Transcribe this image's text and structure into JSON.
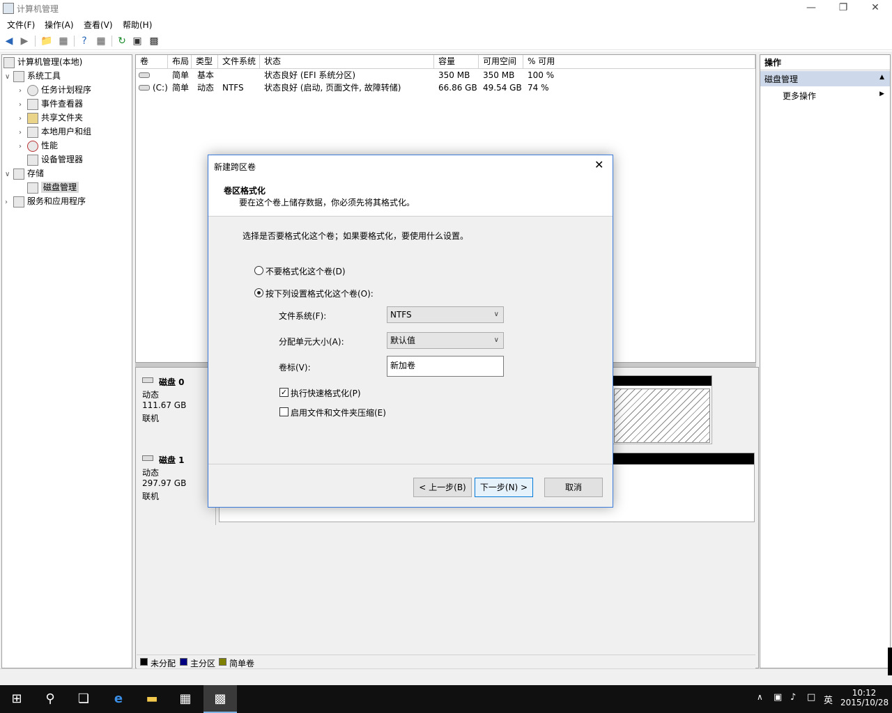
{
  "window": {
    "title": "计算机管理"
  },
  "menu": [
    "文件(F)",
    "操作(A)",
    "查看(V)",
    "帮助(H)"
  ],
  "tree": {
    "root": "计算机管理(本地)",
    "system_tools": "系统工具",
    "task_scheduler": "任务计划程序",
    "event_viewer": "事件查看器",
    "shared_folders": "共享文件夹",
    "local_users": "本地用户和组",
    "performance": "性能",
    "device_manager": "设备管理器",
    "storage": "存储",
    "disk_management": "磁盘管理",
    "services_apps": "服务和应用程序"
  },
  "volumes": {
    "headers": [
      "卷",
      "布局",
      "类型",
      "文件系统",
      "状态",
      "容量",
      "可用空间",
      "% 可用"
    ],
    "rows": [
      {
        "vol": "",
        "layout": "简单",
        "type": "基本",
        "fs": "",
        "status": "状态良好 (EFI 系统分区)",
        "capacity": "350 MB",
        "free": "350 MB",
        "pct": "100 %"
      },
      {
        "vol": "(C:)",
        "layout": "简单",
        "type": "动态",
        "fs": "NTFS",
        "status": "状态良好 (启动, 页面文件, 故障转储)",
        "capacity": "66.86 GB",
        "free": "49.54 GB",
        "pct": "74 %"
      }
    ]
  },
  "disks": [
    {
      "name": "磁盘 0",
      "type": "动态",
      "size": "111.67 GB",
      "state": "联机"
    },
    {
      "name": "磁盘 1",
      "type": "动态",
      "size": "297.97 GB",
      "state": "联机"
    }
  ],
  "legend": {
    "unallocated": "未分配",
    "primary": "主分区",
    "simple": "简单卷",
    "colors": {
      "unallocated": "#000000",
      "primary": "#000080",
      "simple": "#808000"
    }
  },
  "actions": {
    "title": "操作",
    "section": "磁盘管理",
    "more": "更多操作"
  },
  "dialog": {
    "title": "新建跨区卷",
    "heading": "卷区格式化",
    "subheading": "要在这个卷上储存数据，你必须先将其格式化。",
    "prompt": "选择是否要格式化这个卷；如果要格式化，要使用什么设置。",
    "opt_no_format": "不要格式化这个卷(D)",
    "opt_format": "按下列设置格式化这个卷(O):",
    "fs_label": "文件系统(F):",
    "fs_value": "NTFS",
    "alloc_label": "分配单元大小(A):",
    "alloc_value": "默认值",
    "vol_label": "卷标(V):",
    "vol_value": "新加卷",
    "quick_format": "执行快速格式化(P)",
    "compress": "启用文件和文件夹压缩(E)",
    "back": "< 上一步(B)",
    "next": "下一步(N) >",
    "cancel": "取消"
  },
  "taskbar": {
    "ime": "英",
    "time": "10:12",
    "date": "2015/10/28"
  }
}
